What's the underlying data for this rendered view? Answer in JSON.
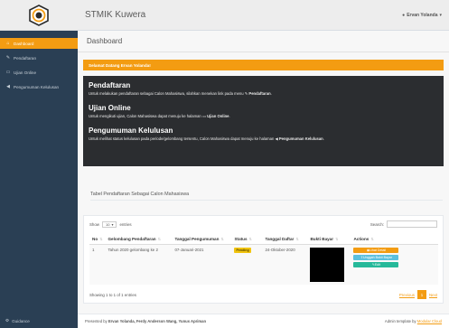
{
  "brand": {
    "title": "STMIK Kuwera"
  },
  "user": {
    "name": "Ervan Yolanda"
  },
  "sidebar": {
    "items": [
      {
        "label": "Dashboard",
        "icon": "home-icon"
      },
      {
        "label": "Pendaftaran",
        "icon": "edit-icon"
      },
      {
        "label": "Ujian Online",
        "icon": "desktop-icon"
      },
      {
        "label": "Pengumuman Kelulusan",
        "icon": "bullhorn-icon"
      }
    ],
    "footer": "Guidance"
  },
  "page": {
    "title": "Dashboard"
  },
  "welcome": "Selamat Datang Ervan Yolanda!",
  "info": [
    {
      "heading": "Pendaftaran",
      "text": "Untuk melakukan pendaftaran sebagai Calon Mahasiswa, silahkan menekan link pada menu ",
      "link": "Pendaftaran",
      "tail": "."
    },
    {
      "heading": "Ujian Online",
      "text": "Untuk mengikuti ujian, Calon Mahasiswa dapat menuju ke halaman ",
      "link": "Ujian Online",
      "tail": "."
    },
    {
      "heading": "Pengumuman Kelulusan",
      "text": "Untuk melihat status kelulusan pada periode/gelombang tersentu, Calon Mahasiswa dapat menuju ke halaman ",
      "link": "Pengumuman Kelulusan",
      "tail": "."
    }
  ],
  "table": {
    "title": "Tabel Pendaftaran Sebagai Calon Mahasiswa",
    "show_label": "Show",
    "show_value": "10",
    "entries_label": "entries",
    "search_label": "Search:",
    "headers": [
      "No",
      "Gelombang Pendaftaran",
      "Tanggal Pengumuman",
      "Status",
      "Tanggal Daftar",
      "Bukti Bayar",
      "Actions"
    ],
    "rows": [
      {
        "no": "1",
        "gelombang": "Tahun 2020 gelombang ke 2",
        "tgl_pengumuman": "07-Januari-2021",
        "status": "Pending",
        "tgl_daftar": "24-Oktober-2020"
      }
    ],
    "actions": [
      "Lihat Detail",
      "Unggah Bukti Bayar",
      "Edit"
    ],
    "showing": "Showing 1 to 1 of 1 entries",
    "previous": "Previous",
    "page": "1",
    "next": "Next"
  },
  "footer": {
    "left_prefix": "Presented by ",
    "authors": "Ervan Yolanda, Ferdy Anderson Wang, Yunus Apriman",
    "right_prefix": "Admin template by ",
    "right_link": "Modular Cloud"
  },
  "colors": {
    "accent": "#f39c12",
    "sidebar": "#2a3f54",
    "info_box": "#2b2d30",
    "success": "#26b99a",
    "info": "#5bc0de",
    "warning": "#f1c40f"
  }
}
